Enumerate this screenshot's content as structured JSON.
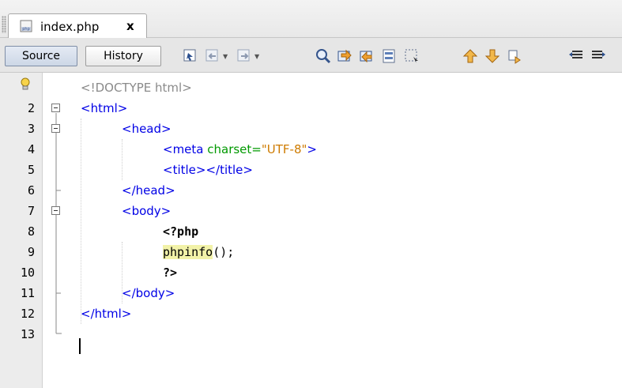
{
  "tab": {
    "title": "index.php",
    "close": "x"
  },
  "toolbar": {
    "source_label": "Source",
    "history_label": "History"
  },
  "editor": {
    "line_numbers": [
      "2",
      "3",
      "4",
      "5",
      "6",
      "7",
      "8",
      "9",
      "10",
      "11",
      "12",
      "13"
    ],
    "lines": {
      "l1": "<!DOCTYPE html>",
      "l2": "<html>",
      "l3": "<head>",
      "l4_tag": "<meta ",
      "l4_attr": "charset=",
      "l4_val": "\"UTF-8\"",
      "l4_end": ">",
      "l5": "<title></title>",
      "l6": "</head>",
      "l7": "<body>",
      "l8": "<?php",
      "l9_fn": "phpinfo",
      "l9_rest": "();",
      "l10": "?>",
      "l11": "</body>",
      "l12": "</html>"
    }
  }
}
